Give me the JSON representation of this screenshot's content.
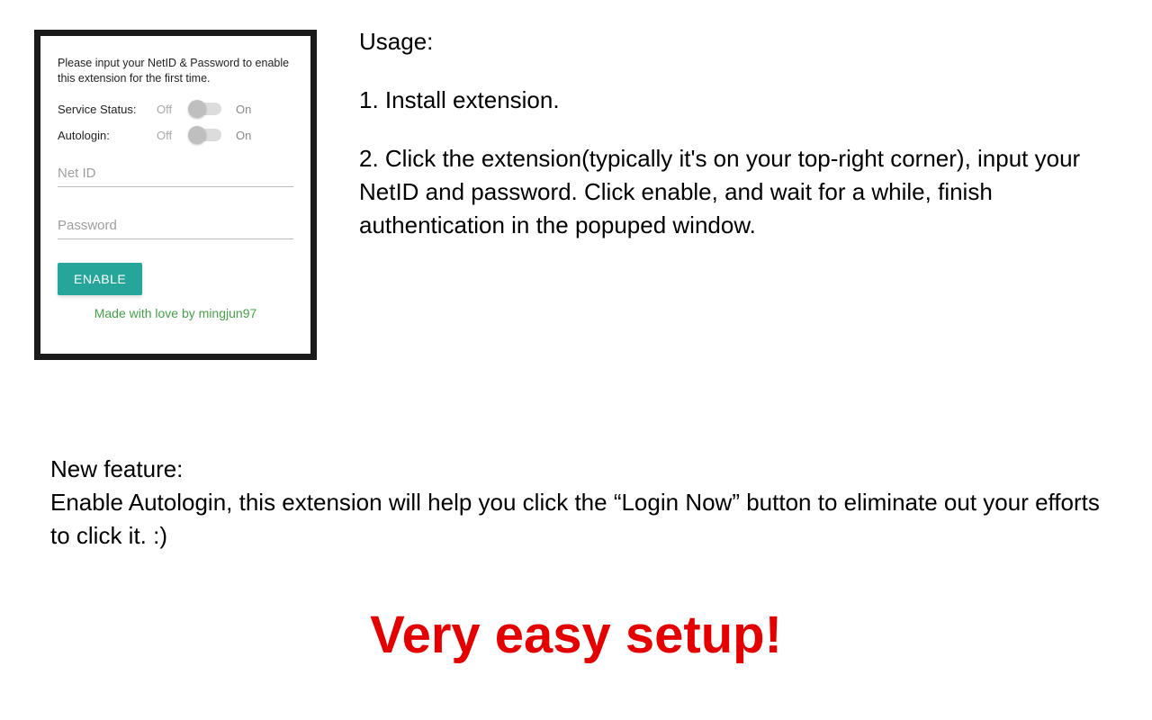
{
  "popup": {
    "intro": "Please input your NetID & Password to enable this extension for the first time.",
    "service_status_label": "Service Status:",
    "autologin_label": "Autologin:",
    "off_text": "Off",
    "on_text": "On",
    "netid_placeholder": "Net ID",
    "password_placeholder": "Password",
    "enable_button": "ENABLE",
    "credit": "Made with love by mingjun97"
  },
  "usage": {
    "heading": "Usage:",
    "step1": "1. Install extension.",
    "step2": "2. Click the extension(typically it's on your top-right corner), input your NetID and password. Click enable, and wait for a while, finish authentication in the popuped window."
  },
  "feature": {
    "heading": "New feature:",
    "body": "Enable Autologin, this extension will help you click the “Login Now” button to eliminate out your efforts to click it. :)"
  },
  "tagline": "Very easy setup!"
}
